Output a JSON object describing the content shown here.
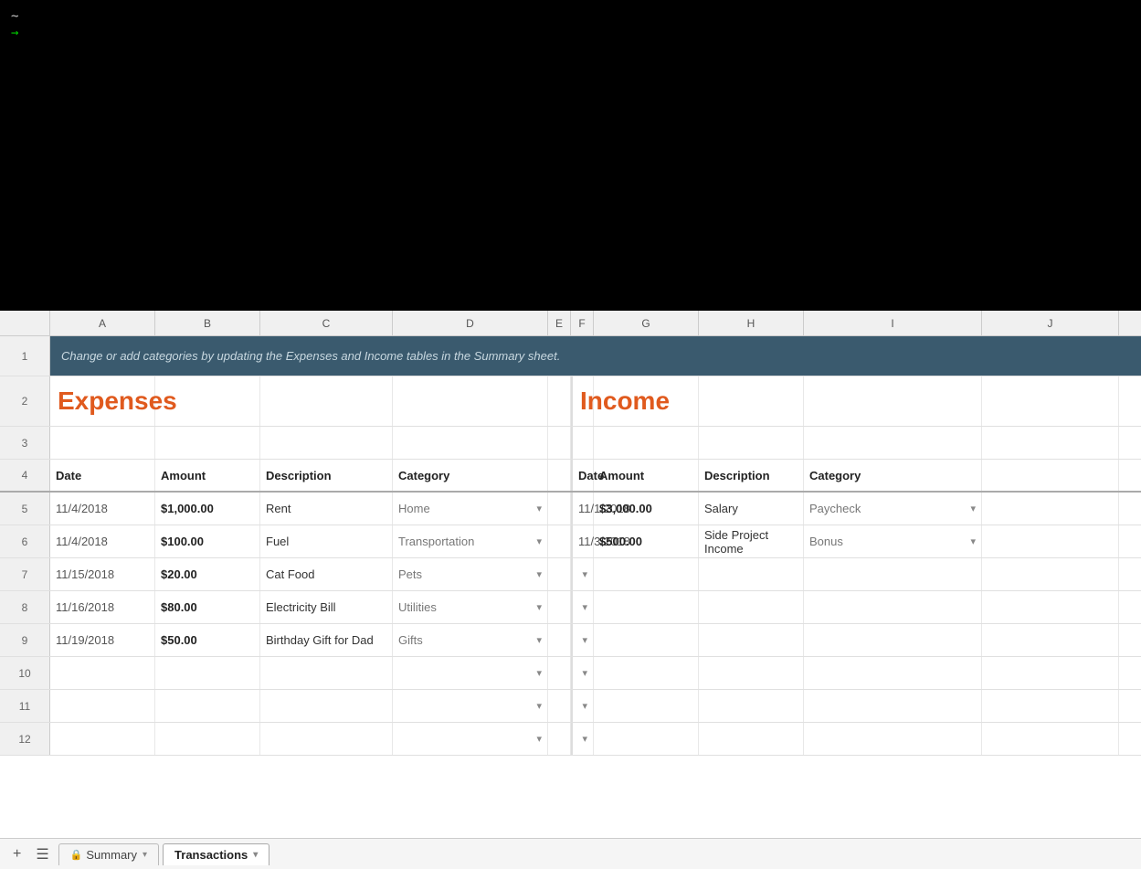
{
  "terminal": {
    "tilde": "~",
    "arrow": "→"
  },
  "spreadsheet": {
    "banner": "Change or add categories by updating the Expenses and Income tables in the Summary sheet.",
    "columns": [
      "A",
      "B",
      "C",
      "D",
      "E",
      "F",
      "G",
      "H",
      "I",
      "J"
    ],
    "row_numbers": [
      1,
      2,
      3,
      4,
      5,
      6,
      7,
      8,
      9,
      10,
      11,
      12
    ],
    "expenses": {
      "title": "Expenses",
      "headers": {
        "date": "Date",
        "amount": "Amount",
        "description": "Description",
        "category": "Category"
      },
      "rows": [
        {
          "date": "11/4/2018",
          "amount": "$1,000.00",
          "description": "Rent",
          "category": "Home"
        },
        {
          "date": "11/4/2018",
          "amount": "$100.00",
          "description": "Fuel",
          "category": "Transportation"
        },
        {
          "date": "11/15/2018",
          "amount": "$20.00",
          "description": "Cat Food",
          "category": "Pets"
        },
        {
          "date": "11/16/2018",
          "amount": "$80.00",
          "description": "Electricity Bill",
          "category": "Utilities"
        },
        {
          "date": "11/19/2018",
          "amount": "$50.00",
          "description": "Birthday Gift for Dad",
          "category": "Gifts"
        }
      ]
    },
    "income": {
      "title": "Income",
      "headers": {
        "date": "Date",
        "amount": "Amount",
        "description": "Description",
        "category": "Category"
      },
      "rows": [
        {
          "date": "11/1/2018",
          "amount": "$3,000.00",
          "description": "Salary",
          "category": "Paycheck"
        },
        {
          "date": "11/3/2018",
          "amount": "$500.00",
          "description": "Side Project Income",
          "category": "Bonus"
        }
      ]
    }
  },
  "tabs": {
    "add_label": "+",
    "menu_label": "☰",
    "summary_label": "Summary",
    "transactions_label": "Transactions"
  },
  "colors": {
    "accent_orange": "#e05a1e",
    "banner_bg": "#3a5a6e",
    "banner_text": "#c8d8e0"
  }
}
